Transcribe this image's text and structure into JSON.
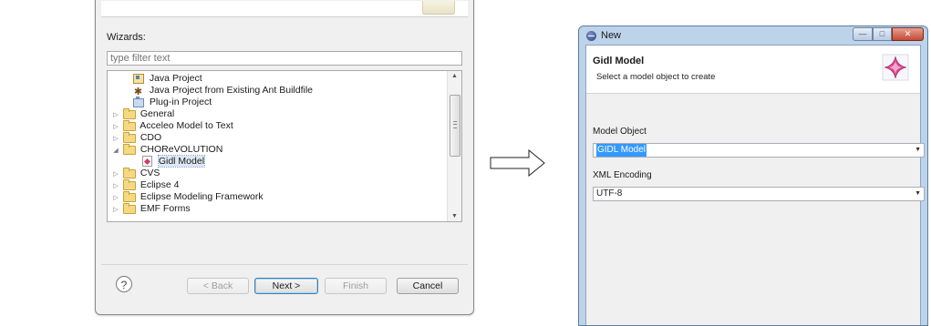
{
  "wizard_dialog": {
    "wizards_label": "Wizards:",
    "filter_placeholder": "type filter text",
    "tree_items": [
      {
        "label": "Java Project",
        "icon": "java-project-icon",
        "expander": ""
      },
      {
        "label": "Java Project from Existing Ant Buildfile",
        "icon": "ant-icon",
        "expander": ""
      },
      {
        "label": "Plug-in Project",
        "icon": "plugin-project-icon",
        "expander": ""
      },
      {
        "label": "General",
        "icon": "folder-icon",
        "expander": "▷"
      },
      {
        "label": "Acceleo Model to Text",
        "icon": "folder-icon",
        "expander": "▷"
      },
      {
        "label": "CDO",
        "icon": "folder-icon",
        "expander": "▷"
      },
      {
        "label": "CHOReVOLUTION",
        "icon": "folder-icon",
        "expander": "◢"
      },
      {
        "label": "Gidl Model",
        "icon": "gidl-model-icon",
        "expander": ""
      },
      {
        "label": "CVS",
        "icon": "folder-icon",
        "expander": "▷"
      },
      {
        "label": "Eclipse 4",
        "icon": "folder-icon",
        "expander": "▷"
      },
      {
        "label": "Eclipse Modeling Framework",
        "icon": "folder-icon",
        "expander": "▷"
      },
      {
        "label": "EMF Forms",
        "icon": "folder-icon",
        "expander": "▷"
      }
    ],
    "selected_item": "Gidl Model",
    "buttons": {
      "help": "?",
      "back": "< Back",
      "next": "Next >",
      "finish": "Finish",
      "cancel": "Cancel"
    }
  },
  "new_dialog": {
    "window_title": "New",
    "header_title": "Gidl Model",
    "header_description": "Select a model object to create",
    "model_object_label": "Model Object",
    "model_object_value": "GIDL Model",
    "xml_encoding_label": "XML Encoding",
    "xml_encoding_value": "UTF-8",
    "window_controls": {
      "minimize": "—",
      "maximize": "□",
      "close": "✕"
    }
  },
  "colors": {
    "window_frame": "#bcd3ea",
    "selection": "#3399ff",
    "close_button": "#c44a33"
  }
}
